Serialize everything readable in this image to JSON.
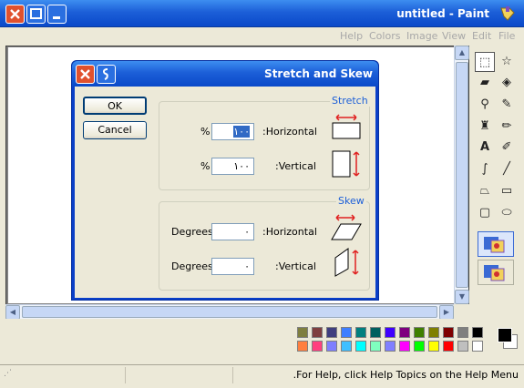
{
  "app": {
    "title": "untitled - Paint",
    "menu": [
      "Help",
      "Colors",
      "Image",
      "View",
      "Edit",
      "File"
    ]
  },
  "dialog": {
    "title": "Stretch and Skew",
    "ok_label": "OK",
    "cancel_label": "Cancel",
    "stretch": {
      "label": "Stretch",
      "percent_symbol": "%",
      "horizontal_label": ":Horizontal",
      "horizontal_value": "١٠٠",
      "vertical_label": ":Vertical",
      "vertical_value": "١٠٠"
    },
    "skew": {
      "label": "Skew",
      "degrees_label": "Degrees",
      "horizontal_label": ":Horizontal",
      "horizontal_value": "٠",
      "vertical_label": ":Vertical",
      "vertical_value": "٠"
    }
  },
  "status": {
    "help_text": ".For Help, click Help Topics on the Help Menu"
  },
  "palette": {
    "row1": [
      "#7f7f3f",
      "#7f3f3f",
      "#3f3f7f",
      "#3f7fff",
      "#007f7f",
      "#005f5f",
      "#3f00ff",
      "#7f007f",
      "#3f7f00",
      "#7f7f00",
      "#7f0000",
      "#7f7f7f",
      "#000000"
    ],
    "row2": [
      "#ff7f3f",
      "#ff3f7f",
      "#7f7fff",
      "#3fbfff",
      "#00ffff",
      "#7fffbf",
      "#7f7fff",
      "#ff00ff",
      "#00ff00",
      "#ffff00",
      "#ff0000",
      "#bfbfbf",
      "#ffffff"
    ],
    "foreground": "#000000",
    "background": "#ffffff"
  },
  "colors": {
    "titlebar": "#0a49c9",
    "close_button": "#e0512e",
    "dialog_group_label": "#1c5fd8",
    "arrow_red": "#e02020"
  }
}
